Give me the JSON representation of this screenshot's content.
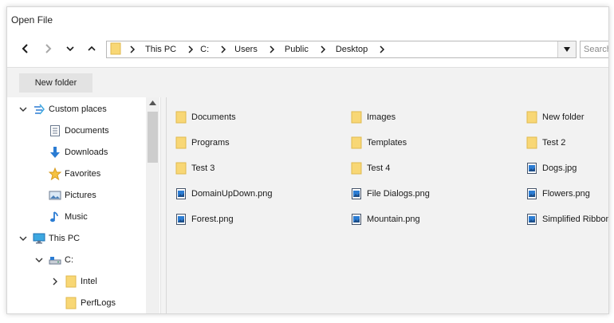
{
  "window": {
    "title": "Open File"
  },
  "address": {
    "crumbs": [
      "This PC",
      "C:",
      "Users",
      "Public",
      "Desktop"
    ]
  },
  "search": {
    "placeholder": "Search"
  },
  "toolbar": {
    "new_folder_label": "New folder"
  },
  "tree": {
    "items": [
      {
        "label": "Custom places",
        "icon": "custom-places-icon",
        "expander": "expanded"
      },
      {
        "label": "Documents",
        "icon": "documents-icon",
        "expander": "none"
      },
      {
        "label": "Downloads",
        "icon": "downloads-icon",
        "expander": "none"
      },
      {
        "label": "Favorites",
        "icon": "favorites-star-icon",
        "expander": "none"
      },
      {
        "label": "Pictures",
        "icon": "pictures-icon",
        "expander": "none"
      },
      {
        "label": "Music",
        "icon": "music-note-icon",
        "expander": "none"
      },
      {
        "label": "This PC",
        "icon": "computer-icon",
        "expander": "expanded"
      },
      {
        "label": "C:",
        "icon": "drive-icon",
        "expander": "expanded"
      },
      {
        "label": "Intel",
        "icon": "folder-icon",
        "expander": "collapsed"
      },
      {
        "label": "PerfLogs",
        "icon": "folder-icon",
        "expander": "none"
      }
    ]
  },
  "files": {
    "items": [
      {
        "label": "Documents",
        "icon": "folder-icon"
      },
      {
        "label": "Programs",
        "icon": "folder-icon"
      },
      {
        "label": "Test 3",
        "icon": "folder-icon"
      },
      {
        "label": "DomainUpDown.png",
        "icon": "image-file-icon"
      },
      {
        "label": "Forest.png",
        "icon": "image-file-icon"
      },
      {
        "label": "Images",
        "icon": "folder-icon"
      },
      {
        "label": "Templates",
        "icon": "folder-icon"
      },
      {
        "label": "Test 4",
        "icon": "folder-icon"
      },
      {
        "label": "File Dialogs.png",
        "icon": "image-file-icon"
      },
      {
        "label": "Mountain.png",
        "icon": "image-file-icon"
      },
      {
        "label": "New folder",
        "icon": "folder-icon"
      },
      {
        "label": "Test 2",
        "icon": "folder-icon"
      },
      {
        "label": "Dogs.jpg",
        "icon": "image-file-icon"
      },
      {
        "label": "Flowers.png",
        "icon": "image-file-icon"
      },
      {
        "label": "Simplified Ribbon.png",
        "icon": "image-file-icon"
      }
    ]
  },
  "colors": {
    "folder": "#f8d775",
    "folder_edge": "#e0b94f",
    "accent_blue": "#2b7cd3"
  }
}
